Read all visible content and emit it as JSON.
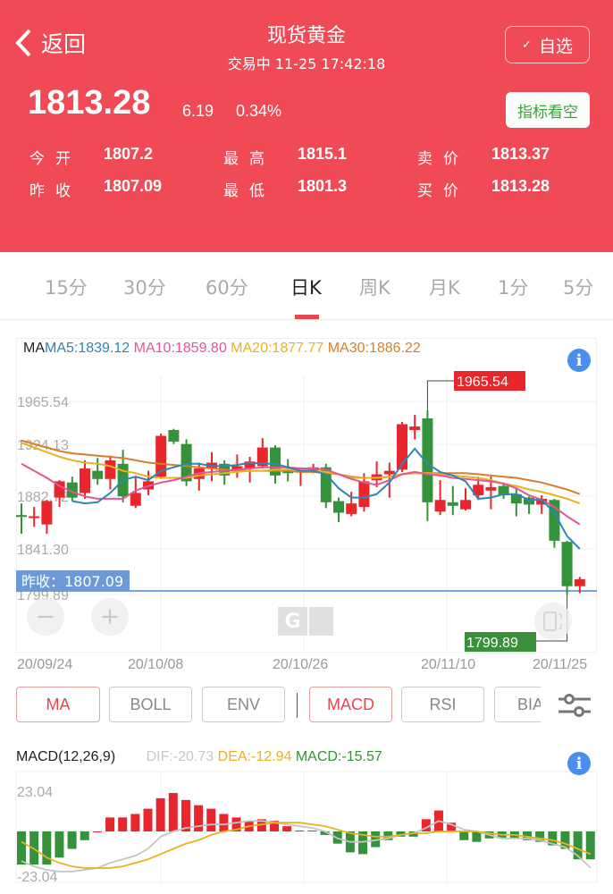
{
  "header": {
    "back_label": "返回",
    "title": "现货黄金",
    "status": "交易中 11-25 17:42:18",
    "favorite_label": "自选",
    "price": "1813.28",
    "change": "6.19",
    "change_pct": "0.34%",
    "signal_label": "指标看空",
    "stats": [
      {
        "label": "今开",
        "value": "1807.2"
      },
      {
        "label": "最高",
        "value": "1815.1"
      },
      {
        "label": "卖价",
        "value": "1813.37"
      },
      {
        "label": "昨收",
        "value": "1807.09"
      },
      {
        "label": "最低",
        "value": "1801.3"
      },
      {
        "label": "买价",
        "value": "1813.28"
      }
    ]
  },
  "tabs": [
    {
      "label": "15分",
      "active": false
    },
    {
      "label": "30分",
      "active": false
    },
    {
      "label": "60分",
      "active": false
    },
    {
      "label": "日K",
      "active": true
    },
    {
      "label": "周K",
      "active": false
    },
    {
      "label": "月K",
      "active": false
    },
    {
      "label": "1分",
      "active": false
    },
    {
      "label": "5分",
      "active": false
    }
  ],
  "indicator_buttons": {
    "main": [
      {
        "label": "MA",
        "active": true
      },
      {
        "label": "BOLL",
        "active": false
      },
      {
        "label": "ENV",
        "active": false
      }
    ],
    "sub": [
      {
        "label": "MACD",
        "active": true
      },
      {
        "label": "RSI",
        "active": false
      },
      {
        "label": "BIAS",
        "active": false
      }
    ]
  },
  "icons": {
    "back": "chevron-left-icon",
    "favorite": "check-icon",
    "info": "info-icon",
    "settings": "sliders-icon",
    "zoom_out": "minus-icon",
    "zoom_in": "plus-icon",
    "rotate": "rotate-screen-icon"
  },
  "colors": {
    "header_bg": "#ef4a55",
    "up": "#e8262c",
    "down": "#34923a",
    "ma5": "#2e86b4",
    "ma10": "#e65593",
    "ma20": "#e8b320",
    "ma30": "#d87f2b",
    "prev_close_line": "#4a86d8",
    "dif": "#c4c4c4",
    "dea": "#e8b320"
  },
  "chart_data": [
    {
      "type": "candlestick",
      "title": "日K",
      "legend": {
        "prefix": "MA",
        "items": [
          {
            "label": "MA5:1839.12",
            "key": "ma5"
          },
          {
            "label": "MA10:1859.80",
            "key": "ma10"
          },
          {
            "label": "MA20:1877.77",
            "key": "ma20"
          },
          {
            "label": "MA30:1886.22",
            "key": "ma30"
          }
        ]
      },
      "y_ticks": [
        "1965.54",
        "1924.13",
        "1882.72",
        "1841.30",
        "1799.89"
      ],
      "ylim": [
        1799.89,
        1965.54
      ],
      "x_ticks": [
        {
          "label": "20/09/24",
          "index": 0
        },
        {
          "label": "20/10/08",
          "index": 9
        },
        {
          "label": "20/10/26",
          "index": 20
        },
        {
          "label": "20/11/10",
          "index": 32
        },
        {
          "label": "20/11/25",
          "index": 43
        }
      ],
      "max_label": "1965.54",
      "min_label": "1799.89",
      "prev_close": {
        "label": "昨收：1807.09",
        "value": 1807.09
      },
      "candles": [
        [
          1868,
          1867,
          1878,
          1852
        ],
        [
          1866,
          1867,
          1875,
          1858
        ],
        [
          1860,
          1880,
          1881,
          1852
        ],
        [
          1883,
          1897,
          1898,
          1875
        ],
        [
          1896,
          1883,
          1901,
          1880
        ],
        [
          1887,
          1908,
          1915,
          1882
        ],
        [
          1906,
          1899,
          1917,
          1894
        ],
        [
          1899,
          1915,
          1919,
          1890
        ],
        [
          1912,
          1884,
          1924,
          1879
        ],
        [
          1876,
          1887,
          1901,
          1874
        ],
        [
          1890,
          1897,
          1906,
          1885
        ],
        [
          1901,
          1936,
          1938,
          1899
        ],
        [
          1941,
          1931,
          1942,
          1929
        ],
        [
          1929,
          1897,
          1933,
          1893
        ],
        [
          1899,
          1908,
          1913,
          1889
        ],
        [
          1908,
          1913,
          1922,
          1897
        ],
        [
          1912,
          1902,
          1915,
          1894
        ],
        [
          1906,
          1910,
          1920,
          1900
        ],
        [
          1908,
          1914,
          1918,
          1896
        ],
        [
          1910,
          1926,
          1934,
          1908
        ],
        [
          1926,
          1902,
          1928,
          1895
        ],
        [
          1906,
          1904,
          1916,
          1897
        ],
        [
          1906,
          1906,
          1909,
          1893
        ],
        [
          1906,
          1909,
          1912,
          1904
        ],
        [
          1909,
          1879,
          1912,
          1874
        ],
        [
          1880,
          1870,
          1883,
          1862
        ],
        [
          1869,
          1878,
          1888,
          1867
        ],
        [
          1875,
          1897,
          1904,
          1871
        ],
        [
          1898,
          1903,
          1914,
          1892
        ],
        [
          1903,
          1906,
          1913,
          1883
        ],
        [
          1907,
          1946,
          1948,
          1905
        ],
        [
          1941,
          1944,
          1954,
          1933
        ],
        [
          1951,
          1879,
          1958,
          1863
        ],
        [
          1871,
          1881,
          1898,
          1868
        ],
        [
          1879,
          1876,
          1893,
          1868
        ],
        [
          1873,
          1881,
          1891,
          1872
        ],
        [
          1885,
          1894,
          1901,
          1881
        ],
        [
          1889,
          1892,
          1901,
          1873
        ],
        [
          1893,
          1885,
          1896,
          1882
        ],
        [
          1886,
          1878,
          1891,
          1867
        ],
        [
          1883,
          1877,
          1884,
          1869
        ],
        [
          1877,
          1882,
          1885,
          1869
        ],
        [
          1881,
          1846,
          1882,
          1840
        ],
        [
          1845,
          1807,
          1846,
          1800
        ],
        [
          1807,
          1813,
          1815,
          1801
        ]
      ],
      "ma5": [
        null,
        null,
        null,
        null,
        1880,
        1878,
        1879,
        1887,
        1898,
        1901,
        1898,
        1906,
        1909,
        1912,
        1912,
        1910,
        1910,
        1911,
        1913,
        1912,
        1912,
        1909,
        1906,
        1906,
        1903,
        1891,
        1883,
        1883,
        1886,
        1896,
        1912,
        1925,
        1912,
        1905,
        1902,
        1897,
        1882,
        1883,
        1886,
        1886,
        1881,
        1881,
        1870,
        1850,
        1839
      ],
      "ma10": [
        1912,
        1906,
        1900,
        1893,
        1888,
        1884,
        1882,
        1882,
        1882,
        1889,
        1893,
        1896,
        1898,
        1901,
        1904,
        1905,
        1906,
        1907,
        1908,
        1909,
        1909,
        1909,
        1908,
        1908,
        1907,
        1903,
        1899,
        1896,
        1894,
        1898,
        1903,
        1905,
        1903,
        1902,
        1900,
        1899,
        1898,
        1897,
        1895,
        1891,
        1885,
        1881,
        1875,
        1867,
        1860
      ],
      "ma20": [
        1930,
        1926,
        1922,
        1918,
        1915,
        1913,
        1912,
        1910,
        1906,
        1904,
        1901,
        1900,
        1900,
        1900,
        1902,
        1903,
        1904,
        1905,
        1906,
        1906,
        1907,
        1907,
        1907,
        1906,
        1905,
        1903,
        1900,
        1900,
        1900,
        1901,
        1903,
        1904,
        1904,
        1903,
        1902,
        1901,
        1900,
        1898,
        1895,
        1893,
        1890,
        1888,
        1885,
        1882,
        1878
      ],
      "ma30": [
        1932,
        1929,
        1926,
        1923,
        1921,
        1920,
        1919,
        1918,
        1917,
        1915,
        1913,
        1912,
        1911,
        1910,
        1909,
        1908,
        1907,
        1906,
        1906,
        1906,
        1906,
        1906,
        1905,
        1905,
        1904,
        1903,
        1901,
        1900,
        1900,
        1901,
        1903,
        1904,
        1904,
        1904,
        1904,
        1904,
        1903,
        1902,
        1901,
        1900,
        1898,
        1896,
        1893,
        1890,
        1886
      ]
    },
    {
      "type": "bar",
      "title": "MACD(12,26,9)",
      "legend": [
        {
          "label": "DIF:-20.73",
          "key": "dif"
        },
        {
          "label": "DEA:-12.94",
          "key": "dea"
        },
        {
          "label": "MACD:-15.57",
          "key": "macd"
        }
      ],
      "y_ticks": [
        "23.04",
        "-23.04"
      ],
      "ylim": [
        -23.04,
        23.04
      ],
      "macd": [
        -19,
        -19,
        -19,
        -15,
        -10,
        -5,
        0,
        8,
        8,
        10,
        13,
        19,
        22,
        18,
        15,
        13,
        10,
        8,
        6,
        7,
        6,
        3,
        0.5,
        0.5,
        -2,
        -7,
        -12,
        -13,
        -9,
        -5,
        -3,
        -3,
        7,
        12,
        5,
        -5,
        -6,
        -4,
        -4,
        -4,
        -5,
        -6,
        -8,
        -10,
        -16,
        -16
      ],
      "dif": [
        -17,
        -20,
        -22,
        -23,
        -23,
        -22,
        -21,
        -18,
        -16,
        -14,
        -10,
        -3,
        0,
        2,
        3,
        4,
        4,
        5,
        6,
        6,
        5,
        4,
        3,
        2,
        0,
        -4,
        -6,
        -6,
        -5,
        -4,
        -2,
        -1,
        2,
        6,
        4,
        1,
        0,
        -2,
        -4,
        -4,
        -4,
        -5,
        -7,
        -9,
        -14,
        -20.73
      ],
      "dea": [
        -6,
        -10,
        -15,
        -18,
        -20,
        -21,
        -21,
        -21,
        -20,
        -18,
        -16,
        -13,
        -10,
        -7,
        -5,
        -2,
        0,
        1,
        3,
        4,
        5,
        5,
        5,
        4,
        3,
        1,
        -1,
        -2,
        -3,
        -3,
        -2,
        -1,
        -1,
        0,
        0,
        0,
        0,
        -1,
        -2,
        -2,
        -3,
        -4,
        -5,
        -7,
        -10,
        -12.94
      ]
    }
  ]
}
